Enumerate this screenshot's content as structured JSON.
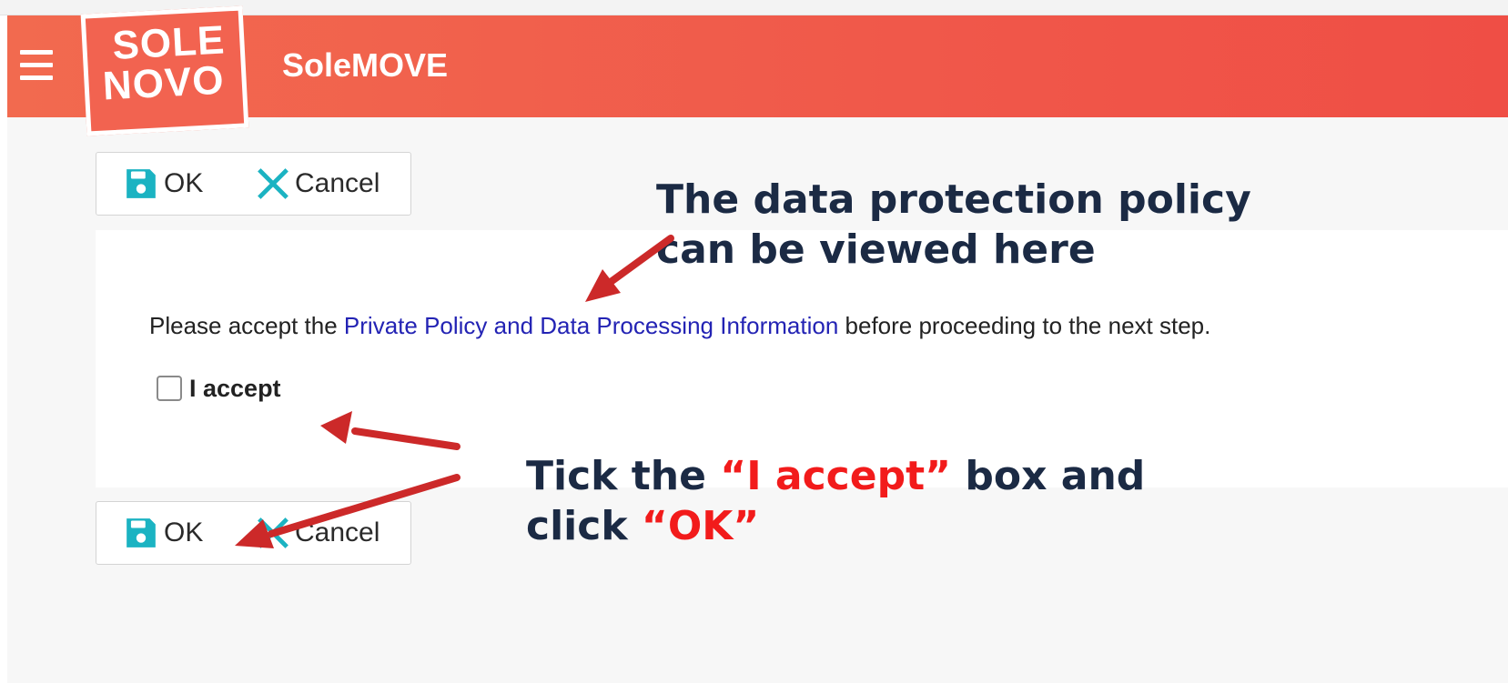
{
  "app": {
    "logo_line1": "SOLE",
    "logo_line2": "NOVO",
    "title": "SoleMOVE",
    "accent_color": "#f0584a"
  },
  "toolbar_top": {
    "ok_label": "OK",
    "cancel_label": "Cancel"
  },
  "toolbar_bottom": {
    "ok_label": "OK",
    "cancel_label": "Cancel"
  },
  "form": {
    "text_before": "Please accept the ",
    "link_text": "Private Policy and Data Processing Information",
    "text_after": " before proceeding to the next step.",
    "checkbox_label": "I accept",
    "checkbox_checked": false
  },
  "annotations": {
    "policy_note_line1": "The data protection policy",
    "policy_note_line2": "can be viewed here",
    "tick_note_prefix": "Tick the ",
    "tick_note_highlight": "“I accept”",
    "tick_note_suffix": " box and",
    "click_note_prefix": "click ",
    "click_note_highlight": "“OK”",
    "arrow_color": "#cc2929",
    "highlight_color": "#f21b1b"
  },
  "icons": {
    "menu": "hamburger-icon",
    "ok": "save-icon",
    "cancel": "close-icon"
  }
}
